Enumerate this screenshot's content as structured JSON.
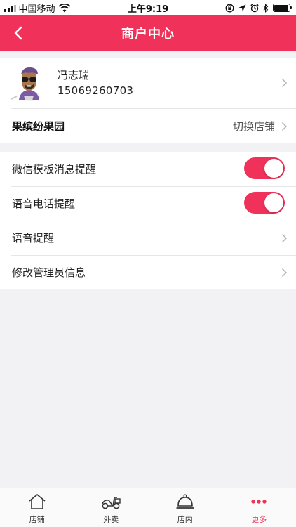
{
  "status_bar": {
    "carrier": "中国移动",
    "time": "上午9:19",
    "battery_level": 0.95
  },
  "nav": {
    "title": "商户中心",
    "back_icon": "chevron-left-icon"
  },
  "profile": {
    "name": "冯志瑞",
    "phone": "15069260703",
    "avatar": "cartoon-avatar"
  },
  "shop": {
    "name": "果缤纷果园",
    "switch_label": "切换店铺"
  },
  "settings": [
    {
      "label": "微信模板消息提醒",
      "control": "toggle",
      "on": true
    },
    {
      "label": "语音电话提醒",
      "control": "toggle",
      "on": true
    },
    {
      "label": "语音提醒",
      "control": "chevron"
    },
    {
      "label": "修改管理员信息",
      "control": "chevron"
    }
  ],
  "tabs": [
    {
      "label": "店铺",
      "icon": "home-icon",
      "active": false
    },
    {
      "label": "外卖",
      "icon": "scooter-icon",
      "active": false
    },
    {
      "label": "店内",
      "icon": "service-bell-icon",
      "active": false
    },
    {
      "label": "更多",
      "icon": "more-dots-icon",
      "active": true
    }
  ],
  "colors": {
    "accent": "#f0325a",
    "background": "#f2f2f4"
  }
}
